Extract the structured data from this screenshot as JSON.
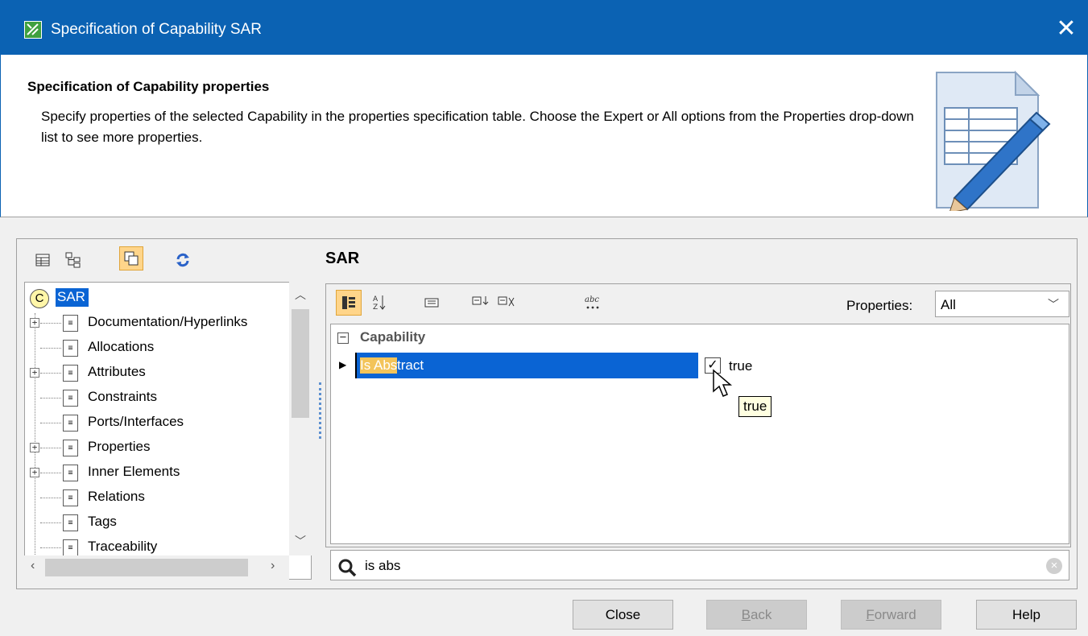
{
  "window": {
    "title": "Specification of Capability SAR",
    "close_glyph": "✕"
  },
  "header": {
    "title": "Specification of Capability properties",
    "description": "Specify properties of the selected Capability in the properties specification table. Choose the Expert or All options from the Properties drop-down list to see more properties."
  },
  "left_toolbar": {
    "buttons": [
      "table-view-icon",
      "tree-view-icon",
      "copy-icon",
      "refresh-icon"
    ]
  },
  "tree": {
    "root": {
      "icon_letter": "C",
      "label": "SAR"
    },
    "items": [
      {
        "label": "Documentation/Hyperlinks",
        "expandable": true
      },
      {
        "label": "Allocations",
        "expandable": false
      },
      {
        "label": "Attributes",
        "expandable": true
      },
      {
        "label": "Constraints",
        "expandable": false
      },
      {
        "label": "Ports/Interfaces",
        "expandable": false
      },
      {
        "label": "Properties",
        "expandable": true
      },
      {
        "label": "Inner Elements",
        "expandable": true
      },
      {
        "label": "Relations",
        "expandable": false
      },
      {
        "label": "Tags",
        "expandable": false
      },
      {
        "label": "Traceability",
        "expandable": false
      }
    ]
  },
  "right": {
    "title": "SAR",
    "properties_label": "Properties:",
    "properties_value": "All",
    "grid": {
      "category": "Capability",
      "rows": [
        {
          "name_highlight": "Is Abs",
          "name_rest": "tract",
          "value": "true",
          "checked": true
        }
      ]
    },
    "tooltip": "true",
    "search": {
      "value": "is abs"
    }
  },
  "buttons": {
    "close": "Close",
    "back_mnemonic": "B",
    "back_rest": "ack",
    "forward_mnemonic": "F",
    "forward_rest": "orward",
    "help": "Help"
  },
  "colors": {
    "titlebar": "#0b62b3",
    "selection": "#0a64d4",
    "search_highlight": "#f3c45a",
    "active_toolbar": "#ffd58a"
  }
}
